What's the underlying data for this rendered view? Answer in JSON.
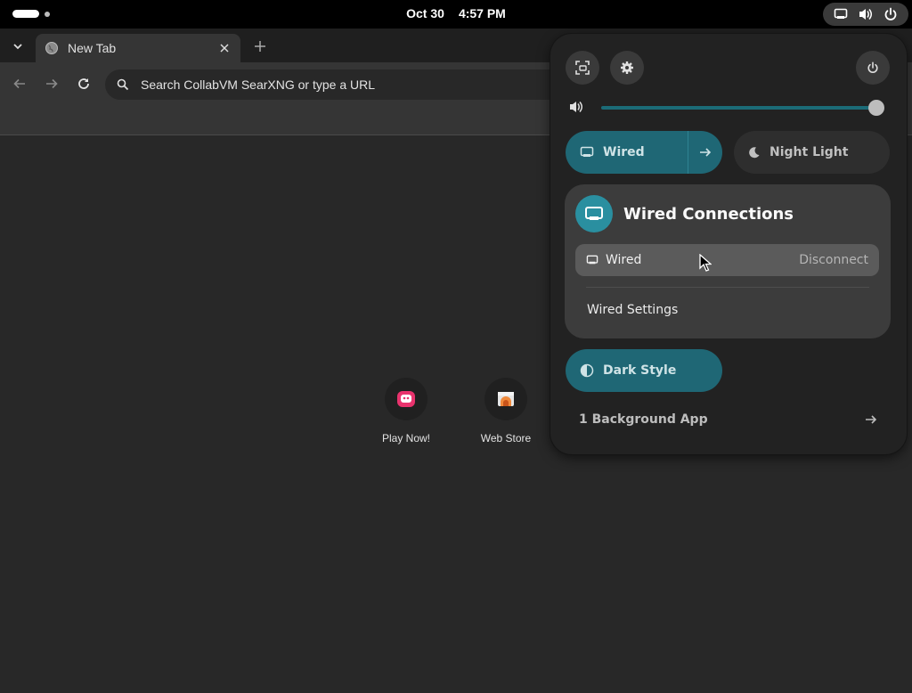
{
  "topbar": {
    "date": "Oct 30",
    "time": "4:57 PM",
    "tray_icons": [
      "network-wired-icon",
      "volume-icon",
      "power-icon"
    ]
  },
  "browser": {
    "tab": {
      "title": "New Tab"
    },
    "omnibox": {
      "placeholder": "Search CollabVM SearXNG or type a URL"
    },
    "shortcuts": [
      {
        "label": "Play Now!",
        "icon": "play-now-icon"
      },
      {
        "label": "Web Store",
        "icon": "web-store-icon"
      }
    ]
  },
  "quick_settings": {
    "buttons": [
      "screenshot-icon",
      "settings-icon",
      "power-icon"
    ],
    "volume": {
      "level": 1.0
    },
    "toggles": {
      "wired": {
        "label": "Wired",
        "active": true
      },
      "night_light": {
        "label": "Night Light",
        "active": false
      },
      "dark_style": {
        "label": "Dark Style",
        "active": true
      }
    },
    "wired_menu": {
      "title": "Wired Connections",
      "item_label": "Wired",
      "item_action": "Disconnect",
      "settings_label": "Wired Settings"
    },
    "background_apps": "1 Background App"
  },
  "colors": {
    "accent": "#1f6775",
    "accent_icon": "#2a8fa0",
    "panel_bg": "#222222",
    "page_bg": "#282828"
  }
}
